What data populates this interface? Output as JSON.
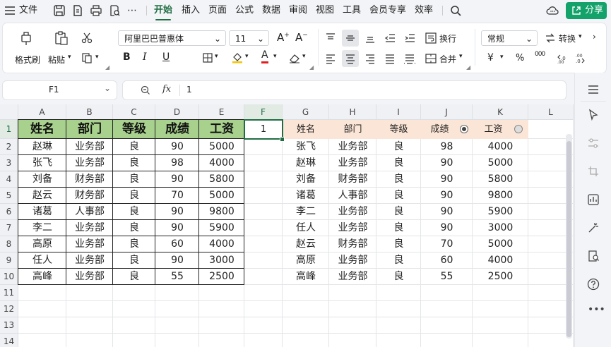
{
  "menubar": {
    "file": "文件",
    "tabs": [
      "开始",
      "插入",
      "页面",
      "公式",
      "数据",
      "审阅",
      "视图",
      "工具",
      "会员专享",
      "效率"
    ],
    "active_tab": "开始",
    "share": "分享"
  },
  "ribbon": {
    "format_painter": "格式刷",
    "paste": "粘贴",
    "font_name": "阿里巴巴普惠体",
    "font_size": "11",
    "wrap": "换行",
    "merge": "合并",
    "number_format": "常规",
    "convert": "转换",
    "currency_symbol": "¥",
    "percent_symbol": "%",
    "thousands_symbol": "000",
    "bold": "B",
    "italic": "I",
    "underline": "U",
    "font_color_letter": "A"
  },
  "formula_bar": {
    "cell_ref": "F1",
    "fx": "fx",
    "content": "1"
  },
  "sheet": {
    "columns": [
      "A",
      "B",
      "C",
      "D",
      "E",
      "F",
      "G",
      "H",
      "I",
      "J",
      "K",
      "L"
    ],
    "rows": [
      "1",
      "2",
      "3",
      "4",
      "5",
      "6",
      "7",
      "8",
      "9",
      "10",
      "11",
      "12",
      "13",
      "14"
    ],
    "selected_cell": "F1",
    "f1_value": "1",
    "table_left": {
      "headers": [
        "姓名",
        "部门",
        "等级",
        "成绩",
        "工资"
      ],
      "rows": [
        [
          "赵琳",
          "业务部",
          "良",
          "90",
          "5000"
        ],
        [
          "张飞",
          "业务部",
          "良",
          "98",
          "4000"
        ],
        [
          "刘备",
          "财务部",
          "良",
          "90",
          "5800"
        ],
        [
          "赵云",
          "财务部",
          "良",
          "70",
          "5000"
        ],
        [
          "诸葛",
          "人事部",
          "良",
          "90",
          "9800"
        ],
        [
          "李二",
          "业务部",
          "良",
          "90",
          "5900"
        ],
        [
          "高原",
          "业务部",
          "良",
          "60",
          "4000"
        ],
        [
          "任人",
          "业务部",
          "良",
          "90",
          "3000"
        ],
        [
          "高峰",
          "业务部",
          "良",
          "55",
          "2500"
        ]
      ]
    },
    "table_right": {
      "headers": [
        "姓名",
        "部门",
        "等级",
        "成绩",
        "工资"
      ],
      "rows": [
        [
          "张飞",
          "业务部",
          "良",
          "98",
          "4000"
        ],
        [
          "赵琳",
          "业务部",
          "良",
          "90",
          "5000"
        ],
        [
          "刘备",
          "财务部",
          "良",
          "90",
          "5800"
        ],
        [
          "诸葛",
          "人事部",
          "良",
          "90",
          "9800"
        ],
        [
          "李二",
          "业务部",
          "良",
          "90",
          "5900"
        ],
        [
          "任人",
          "业务部",
          "良",
          "90",
          "3000"
        ],
        [
          "赵云",
          "财务部",
          "良",
          "70",
          "5000"
        ],
        [
          "高原",
          "业务部",
          "良",
          "60",
          "4000"
        ],
        [
          "高峰",
          "业务部",
          "良",
          "55",
          "2500"
        ]
      ]
    }
  },
  "colors": {
    "accent": "#1f6e43",
    "share": "#12a26a",
    "left_header_fill": "#a9d18e",
    "right_header_fill": "#fbe5d6"
  }
}
